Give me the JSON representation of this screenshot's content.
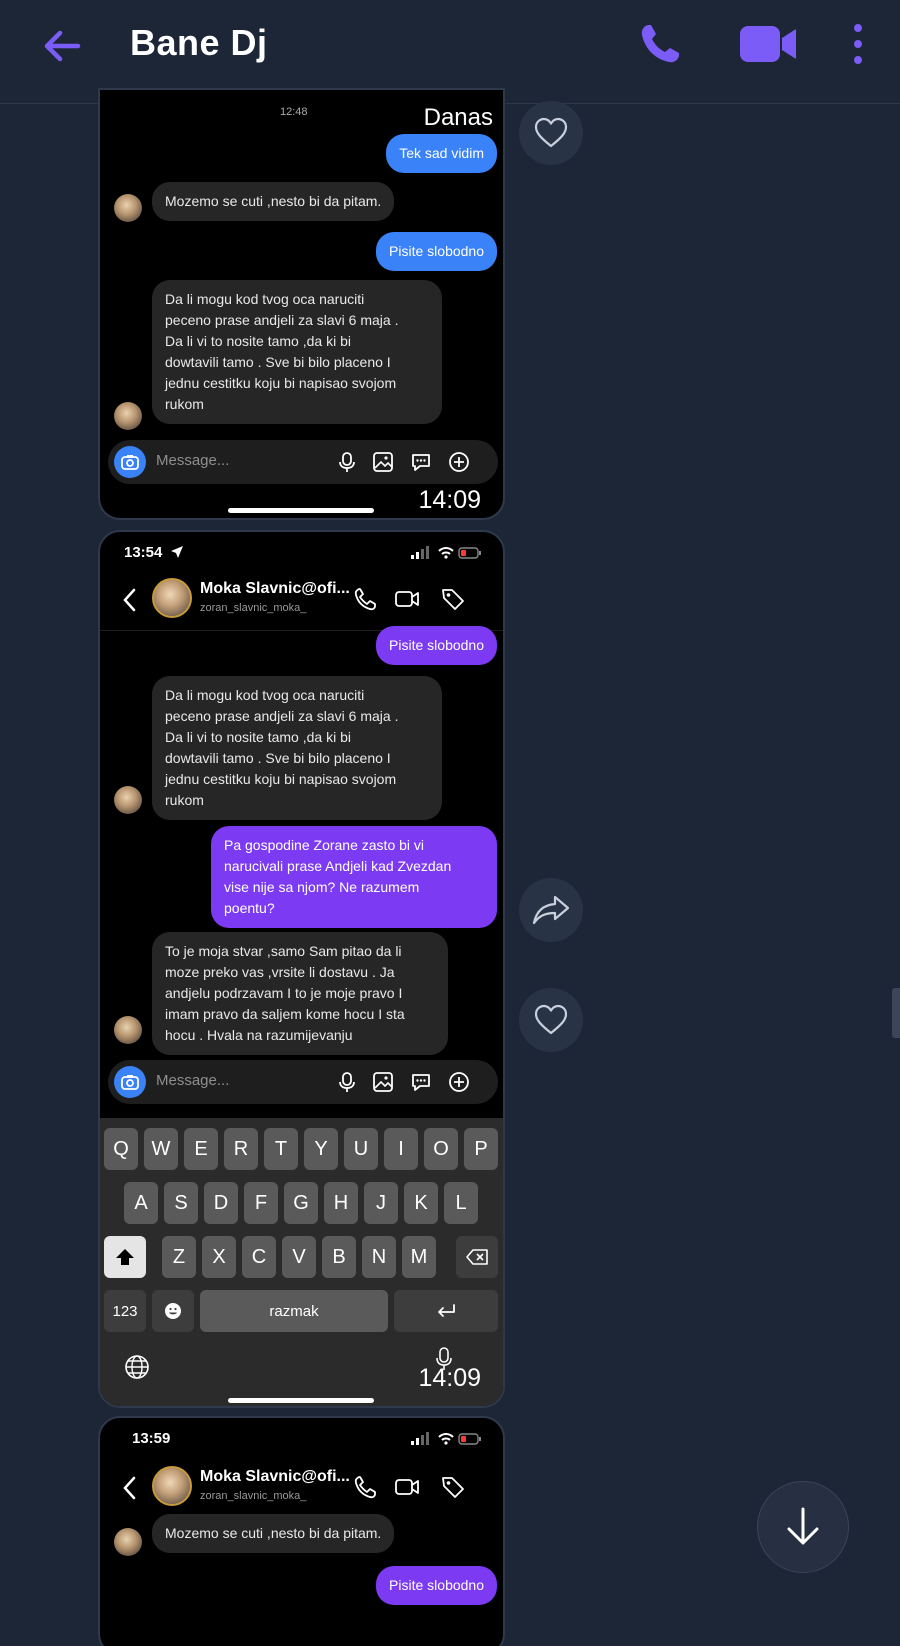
{
  "header": {
    "title": "Bane Dj",
    "back_icon": "arrow-left-icon",
    "call_icon": "phone-icon",
    "video_icon": "video-camera-icon",
    "more_icon": "more-vertical-icon",
    "accent": "#7c5cf6"
  },
  "shot1": {
    "top_time": "12:48",
    "date_label": "Danas",
    "messages": [
      {
        "text": "Tek sad vidim",
        "side": "out"
      },
      {
        "text": "Mozemo se cuti ,nesto bi da pitam.",
        "side": "in"
      },
      {
        "text": "Pisite slobodno",
        "side": "out"
      },
      {
        "lines": [
          "Da li mogu kod tvog oca naruciti",
          "peceno prase andjeli za slavi 6 maja .",
          "Da li vi to nosite tamo ,da ki bi",
          "dowtavili tamo . Sve bi bilo placeno I",
          "jednu cestitku koju bi napisao svojom",
          "rukom"
        ],
        "side": "in"
      }
    ],
    "input_placeholder": "Message...",
    "timestamp": "14:09"
  },
  "shot2": {
    "status_time": "13:54",
    "contact_name": "Moka Slavnic@ofi...",
    "contact_user": "zoran_slavnic_moka_",
    "messages": [
      {
        "text": "Pisite slobodno",
        "side": "out"
      },
      {
        "lines": [
          "Da li mogu kod tvog oca naruciti",
          "peceno prase andjeli za slavi 6 maja .",
          "Da li vi to nosite tamo ,da ki bi",
          "dowtavili tamo . Sve bi bilo placeno I",
          "jednu cestitku koju bi napisao svojom",
          "rukom"
        ],
        "side": "in"
      },
      {
        "lines": [
          "Pa gospodine Zorane zasto bi vi",
          "narucivali prase Andjeli kad Zvezdan",
          "vise nije sa njom? Ne razumem",
          "poentu?"
        ],
        "side": "out"
      },
      {
        "lines": [
          "To je moja stvar ,samo Sam pitao da li",
          "moze preko vas ,vrsite li dostavu . Ja",
          "andjelu podrzavam I to je moje pravo I",
          "imam pravo da saljem kome hocu I sta",
          "hocu . Hvala na razumijevanju"
        ],
        "side": "in"
      }
    ],
    "input_placeholder": "Message...",
    "keyboard": {
      "row1": [
        "Q",
        "W",
        "E",
        "R",
        "T",
        "Y",
        "U",
        "I",
        "O",
        "P"
      ],
      "row2": [
        "A",
        "S",
        "D",
        "F",
        "G",
        "H",
        "J",
        "K",
        "L"
      ],
      "row3": [
        "Z",
        "X",
        "C",
        "V",
        "B",
        "N",
        "M"
      ],
      "num_key": "123",
      "space_key": "razmak"
    },
    "timestamp": "14:09"
  },
  "shot3": {
    "status_time": "13:59",
    "contact_name": "Moka Slavnic@ofi...",
    "contact_user": "zoran_slavnic_moka_",
    "messages": [
      {
        "text": "Mozemo se cuti ,nesto bi da pitam.",
        "side": "in"
      },
      {
        "text": "Pisite slobodno",
        "side": "out"
      }
    ]
  },
  "reactions": {
    "like_icon": "heart-icon",
    "forward_icon": "forward-icon",
    "scroll_icon": "arrow-down-icon"
  }
}
